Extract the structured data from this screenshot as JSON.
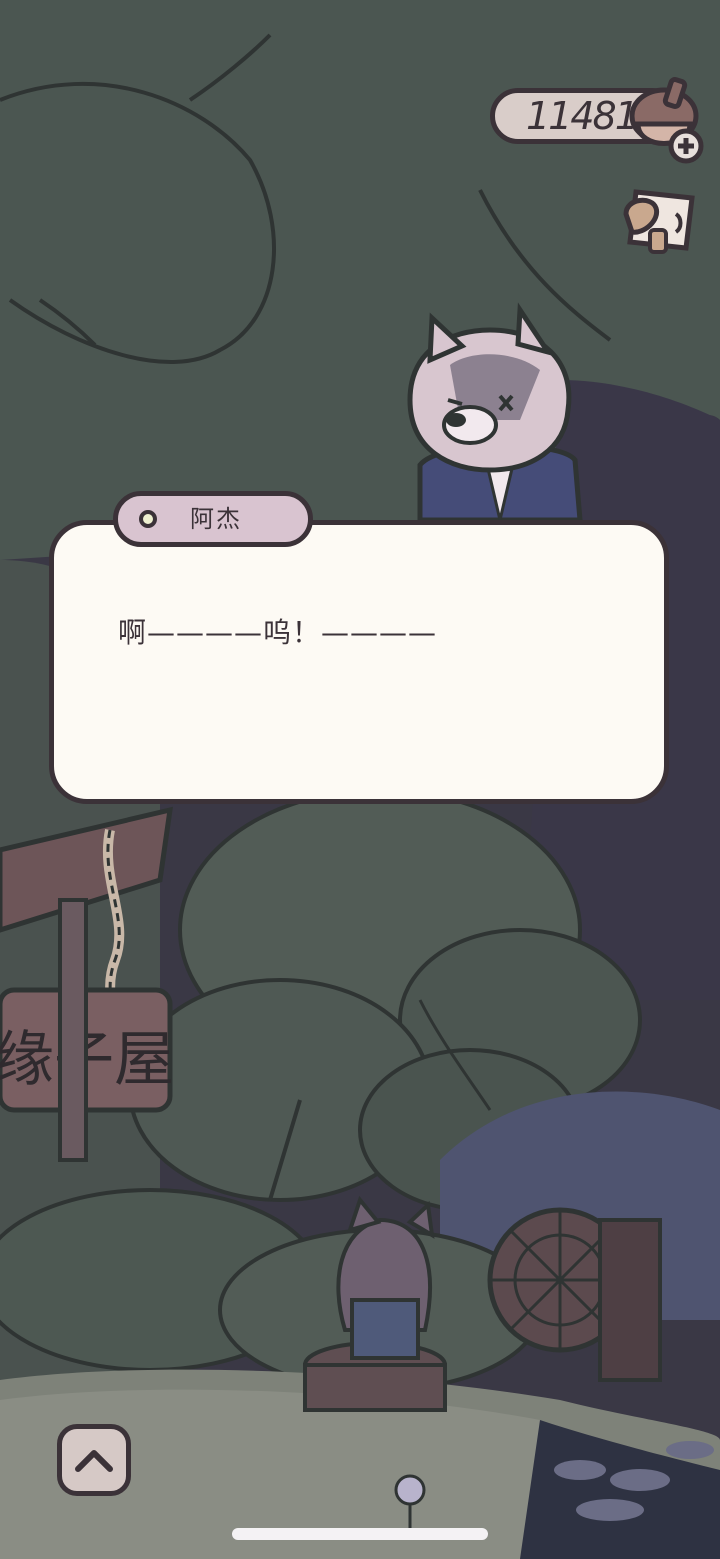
{
  "hud": {
    "currency_value": "11481",
    "currency_icon": "acorn-add-icon",
    "mail_icon": "letter-icon"
  },
  "dialog": {
    "speaker": "阿杰",
    "line": "啊————呜！————"
  },
  "scene": {
    "sign_text": "缘子屋",
    "npc": "wolf"
  },
  "controls": {
    "expand_icon": "chevron-up-icon"
  },
  "colors": {
    "outline": "#3b3238",
    "dialog_bg": "#fdfaf4",
    "name_tag_bg": "#d9c4d0",
    "pill_bg": "#d9cdc9",
    "tree_green": "#4e5b55",
    "night_sky": "#3a3845"
  }
}
